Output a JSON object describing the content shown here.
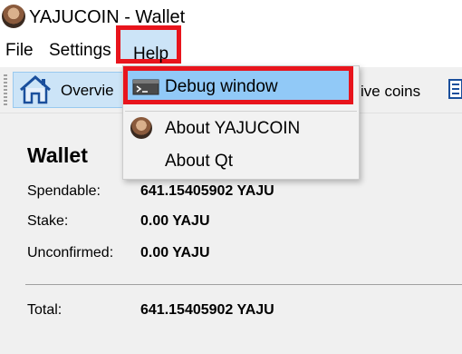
{
  "window": {
    "title": "YAJUCOIN - Wallet",
    "app_icon": "user-avatar-icon"
  },
  "menubar": {
    "file": "File",
    "settings": "Settings",
    "help": "Help"
  },
  "toolbar": {
    "overview_label": "Overvie",
    "receive_label": "ive coins",
    "overview_icon": "home-icon",
    "address_icon": "address-book-icon"
  },
  "help_menu": {
    "items": [
      {
        "label": "Debug window",
        "icon": "terminal-icon"
      },
      {
        "label": "About YAJUCOIN",
        "icon": "user-avatar-icon"
      },
      {
        "label": "About Qt"
      }
    ]
  },
  "wallet": {
    "heading": "Wallet",
    "spendable_label": "Spendable:",
    "spendable_value": "641.15405902 YAJU",
    "stake_label": "Stake:",
    "stake_value": "0.00 YAJU",
    "unconfirmed_label": "Unconfirmed:",
    "unconfirmed_value": "0.00 YAJU",
    "total_label": "Total:",
    "total_value": "641.15405902 YAJU"
  },
  "colors": {
    "highlight_border": "#e8141c",
    "menu_selected": "#91c9f7",
    "toolbar_active": "#cce4f7"
  }
}
